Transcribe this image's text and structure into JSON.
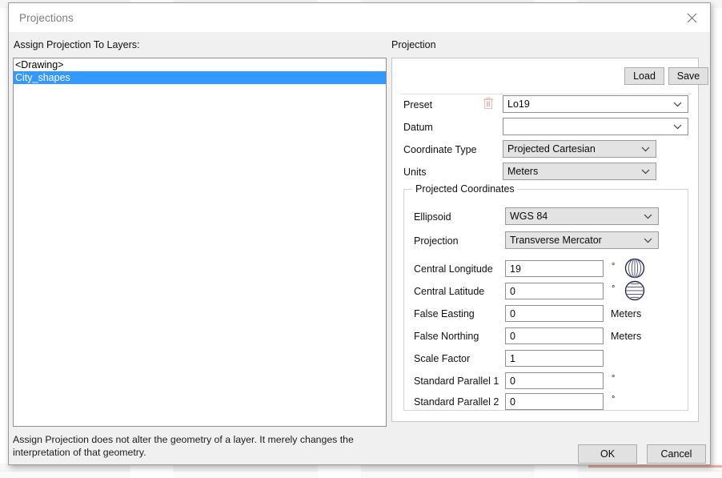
{
  "window": {
    "title": "Projections",
    "close_icon": "close-icon"
  },
  "left": {
    "assign_label": "Assign Projection To Layers:",
    "layers": [
      {
        "name": "<Drawing>",
        "selected": false
      },
      {
        "name": "City_shapes",
        "selected": true
      }
    ],
    "note": "Assign Projection does not alter the geometry of a layer. It merely changes the interpretation of that geometry."
  },
  "right": {
    "heading": "Projection",
    "load_label": "Load",
    "save_label": "Save",
    "delete_preset_icon": "trash-icon",
    "fields": {
      "preset_label": "Preset",
      "preset_value": "Lo19",
      "datum_label": "Datum",
      "datum_value": "",
      "coordinate_type_label": "Coordinate Type",
      "coordinate_type_value": "Projected Cartesian",
      "units_label": "Units",
      "units_value": "Meters"
    },
    "projected_coordinates": {
      "group_title": "Projected Coordinates",
      "ellipsoid_label": "Ellipsoid",
      "ellipsoid_value": "WGS 84",
      "projection_label": "Projection",
      "projection_value": "Transverse Mercator",
      "central_longitude_label": "Central Longitude",
      "central_longitude_value": "19",
      "central_longitude_unit": "°",
      "central_longitude_icon": "globe-meridians-icon",
      "central_latitude_label": "Central Latitude",
      "central_latitude_value": "0",
      "central_latitude_unit": "°",
      "central_latitude_icon": "globe-parallels-icon",
      "false_easting_label": "False Easting",
      "false_easting_value": "0",
      "false_easting_unit": "Meters",
      "false_northing_label": "False Northing",
      "false_northing_value": "0",
      "false_northing_unit": "Meters",
      "scale_factor_label": "Scale Factor",
      "scale_factor_value": "1",
      "standard_parallel_1_label": "Standard Parallel 1",
      "standard_parallel_1_value": "0",
      "standard_parallel_1_unit": "°",
      "standard_parallel_2_label": "Standard Parallel 2",
      "standard_parallel_2_value": "0",
      "standard_parallel_2_unit": "°"
    }
  },
  "footer": {
    "ok_label": "OK",
    "cancel_label": "Cancel"
  },
  "colors": {
    "selection_blue": "#3399ff",
    "dialog_bg": "#f0f0f0",
    "panel_bg": "#ffffff",
    "dropdown_gray": "#e3e3e3",
    "button_gray": "#e1e1e1"
  }
}
